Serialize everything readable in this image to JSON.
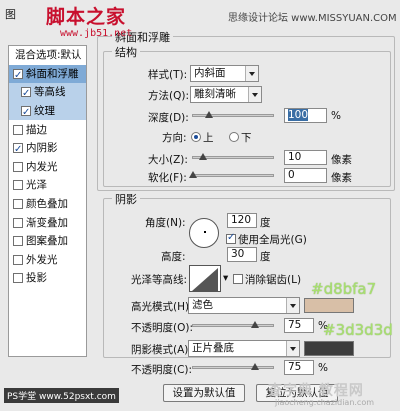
{
  "window": {
    "title": "图层样式"
  },
  "watermarks": {
    "logo": "脚本之家",
    "url": "www.jb51.net",
    "site": "思缘设计论坛 www.MISSYUAN.COM",
    "footer_left": "PS学堂 www.52psxt.com",
    "footer_right": "查字典 教程网",
    "footer_right_url": "jiaocheng.chazidian.com"
  },
  "left_panel": {
    "header": "混合选项:默认",
    "items": [
      {
        "label": "斜面和浮雕",
        "checked": true,
        "active": true
      },
      {
        "label": "等高线",
        "checked": true,
        "sub": true,
        "active": true
      },
      {
        "label": "纹理",
        "checked": true,
        "sub": true,
        "active": true
      },
      {
        "label": "描边",
        "checked": false
      },
      {
        "label": "内阴影",
        "checked": true
      },
      {
        "label": "内发光",
        "checked": false
      },
      {
        "label": "光泽",
        "checked": false
      },
      {
        "label": "颜色叠加",
        "checked": false
      },
      {
        "label": "渐变叠加",
        "checked": false
      },
      {
        "label": "图案叠加",
        "checked": false
      },
      {
        "label": "外发光",
        "checked": false
      },
      {
        "label": "投影",
        "checked": false
      }
    ]
  },
  "bevel": {
    "group_title": "斜面和浮雕",
    "structure_title": "结构",
    "style_label": "样式(T):",
    "style_value": "内斜面",
    "method_label": "方法(Q):",
    "method_value": "雕刻清晰",
    "depth_label": "深度(D):",
    "depth_value": "100",
    "depth_unit": "%",
    "depth_level": 1.0,
    "direction_label": "方向:",
    "dir_up": "上",
    "dir_down": "下",
    "size_label": "大小(Z):",
    "size_value": "10",
    "size_unit": "像素",
    "soften_label": "软化(F):",
    "soften_value": "0",
    "soften_unit": "像素"
  },
  "shading": {
    "title": "阴影",
    "angle_label": "角度(N):",
    "angle_value": "120",
    "angle_unit": "度",
    "global_light_label": "使用全局光(G)",
    "global_light_checked": true,
    "altitude_label": "高度:",
    "altitude_value": "30",
    "altitude_unit": "度",
    "gloss_label": "光泽等高线:",
    "antialias_label": "消除锯齿(L)",
    "antialias_checked": false,
    "highlight_mode_label": "高光模式(H):",
    "highlight_mode_value": "滤色",
    "highlight_color": "#d8bfa7",
    "highlight_hex_label": "#d8bfa7",
    "highlight_opacity_label": "不透明度(O):",
    "highlight_opacity_value": "75",
    "highlight_opacity_unit": "%",
    "shadow_mode_label": "阴影模式(A):",
    "shadow_mode_value": "正片叠底",
    "shadow_color": "#3d3d3d",
    "shadow_hex_label": "#3d3d3d",
    "shadow_opacity_label": "不透明度(C):",
    "shadow_opacity_value": "75",
    "shadow_opacity_unit": "%"
  },
  "buttons": {
    "set_default": "设置为默认值",
    "reset_default": "复位为默认值"
  }
}
